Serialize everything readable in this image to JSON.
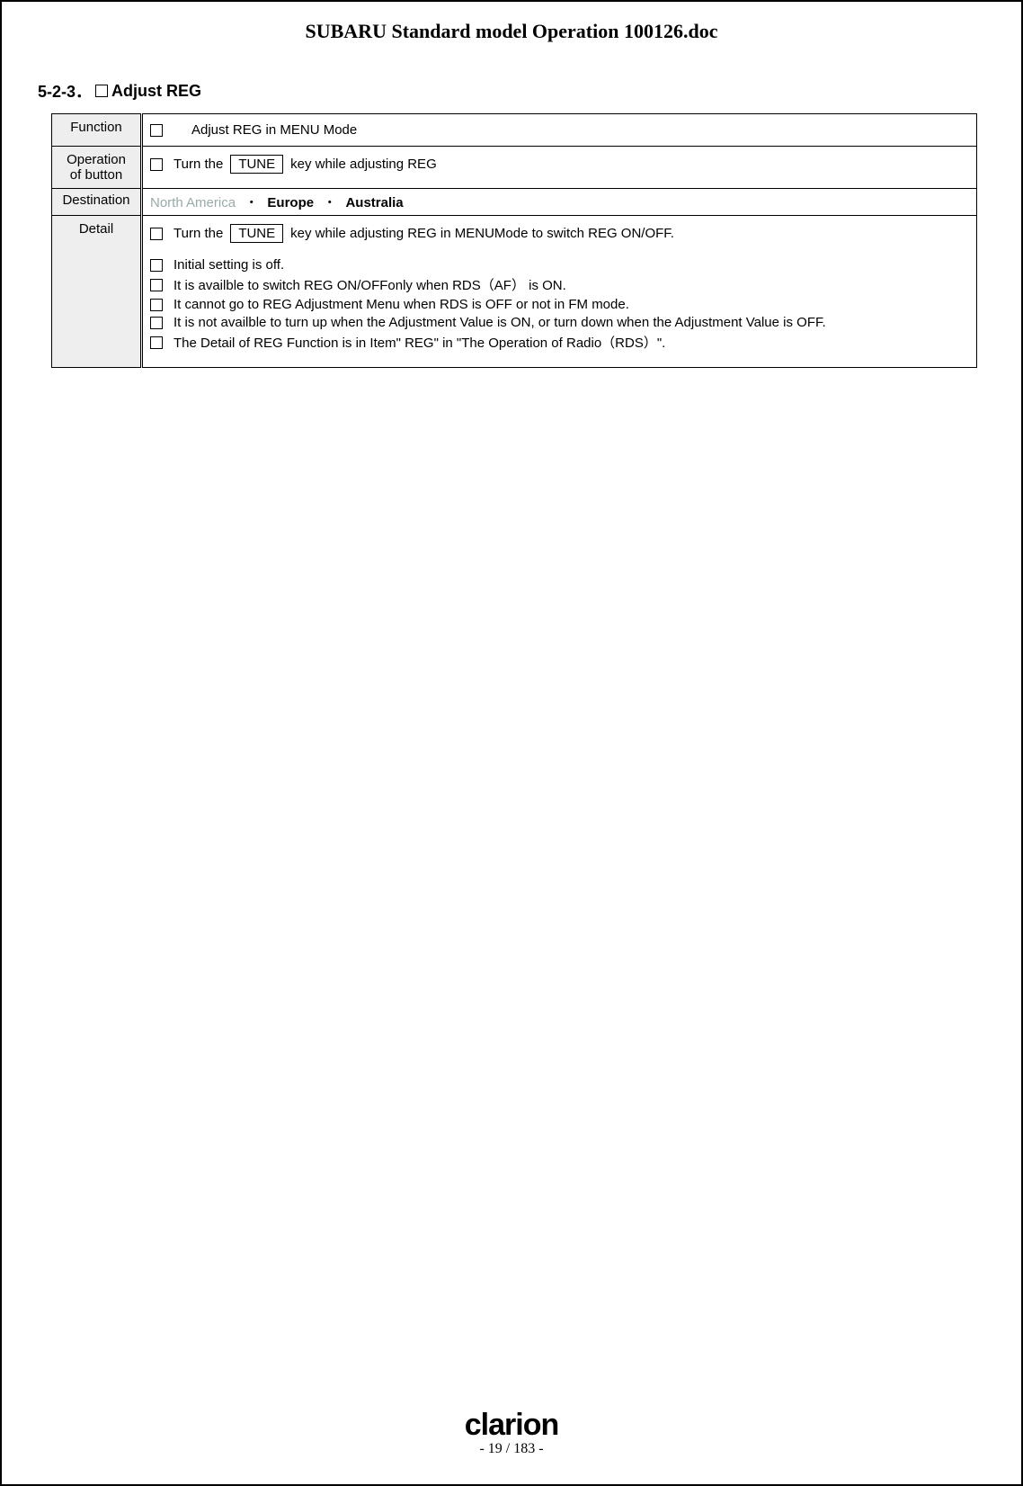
{
  "doc_title": "SUBARU Standard model Operation 100126.doc",
  "section": {
    "number": "5-2-3．",
    "title": "Adjust REG"
  },
  "rows": {
    "function": {
      "label": "Function",
      "text": "Adjust REG in MENU Mode"
    },
    "operation": {
      "label": "Operation of button",
      "pre": "Turn the",
      "key": "TUNE",
      "post": "key while adjusting REG"
    },
    "destination": {
      "label": "Destination",
      "na": "North America",
      "eu": "Europe",
      "au": "Australia",
      "sep": "・"
    },
    "detail": {
      "label": "Detail",
      "line1_pre": "Turn the",
      "line1_key": "TUNE",
      "line1_post": "key while adjusting REG in MENUMode to switch REG ON/OFF.",
      "line2": "Initial setting is off.",
      "line3": "It is availble to switch REG ON/OFFonly when RDS（AF） is ON.",
      "line4": "It cannot go to REG Adjustment Menu when RDS is OFF or not in FM mode.",
      "line5": "It is not availble to turn up when the Adjustment Value is ON, or turn down when the Adjustment Value is OFF.",
      "line6": "The Detail of REG Function is in Item\" REG\" in \"The Operation of Radio（RDS）\"."
    }
  },
  "footer": {
    "brand": "clarion",
    "page": "- 19 / 183 -"
  }
}
